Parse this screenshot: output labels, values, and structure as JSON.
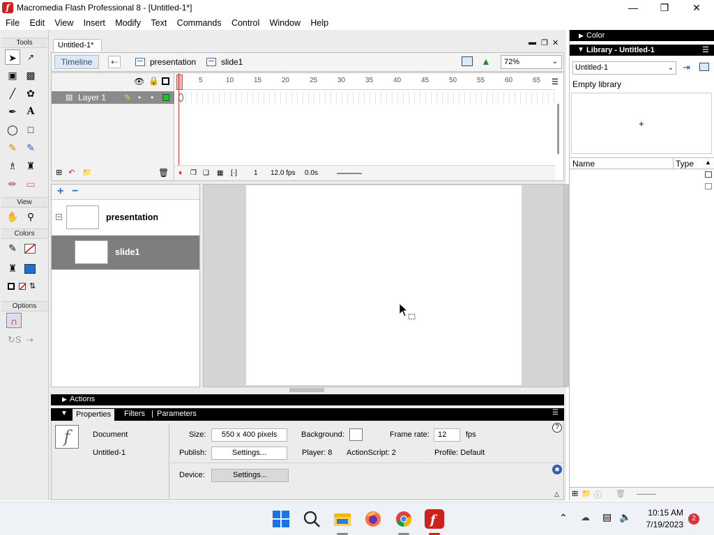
{
  "window": {
    "title": "Macromedia Flash Professional 8 - [Untitled-1*]",
    "app_icon": "flash-f-icon"
  },
  "menu": [
    "File",
    "Edit",
    "View",
    "Insert",
    "Modify",
    "Text",
    "Commands",
    "Control",
    "Window",
    "Help"
  ],
  "toolbox": {
    "tools_label": "Tools",
    "view_label": "View",
    "colors_label": "Colors",
    "options_label": "Options"
  },
  "document": {
    "tab_label": "Untitled-1*",
    "timeline_button": "Timeline",
    "breadcrumb": [
      "presentation",
      "slide1"
    ],
    "zoom": "72%"
  },
  "timeline": {
    "layer_name": "Layer 1",
    "ruler_ticks": [
      "1",
      "5",
      "10",
      "15",
      "20",
      "25",
      "30",
      "35",
      "40",
      "45",
      "50",
      "55",
      "60",
      "65"
    ],
    "current_frame": "1",
    "frame_rate": "12.0 fps",
    "elapsed": "0.0s"
  },
  "slides": [
    {
      "name": "presentation",
      "selected": false
    },
    {
      "name": "slide1",
      "selected": true
    }
  ],
  "panels": {
    "actions_label": "Actions",
    "properties_tab": "Properties",
    "filters_tab": "Filters",
    "parameters_tab": "Parameters"
  },
  "properties": {
    "doc_type": "Document",
    "doc_name": "Untitled-1",
    "size_label": "Size:",
    "size_value": "550 x 400 pixels",
    "background_label": "Background:",
    "framerate_label": "Frame rate:",
    "framerate_value": "12",
    "fps_unit": "fps",
    "publish_label": "Publish:",
    "settings_button": "Settings...",
    "player": "Player: 8",
    "actionscript": "ActionScript:  2",
    "profile": "Profile:  Default",
    "device_label": "Device:",
    "device_settings_button": "Settings..."
  },
  "right": {
    "color_panel": "Color",
    "library_panel": "Library - Untitled-1",
    "library_select": "Untitled-1",
    "empty_library": "Empty library",
    "col_name": "Name",
    "col_type": "Type"
  },
  "taskbar": {
    "time": "10:15 AM",
    "date": "7/19/2023",
    "notification_count": "2"
  },
  "colors": {
    "flash_red": "#d0201c",
    "fill_blue": "#1f6fd1",
    "frame_green": "#22c322"
  }
}
